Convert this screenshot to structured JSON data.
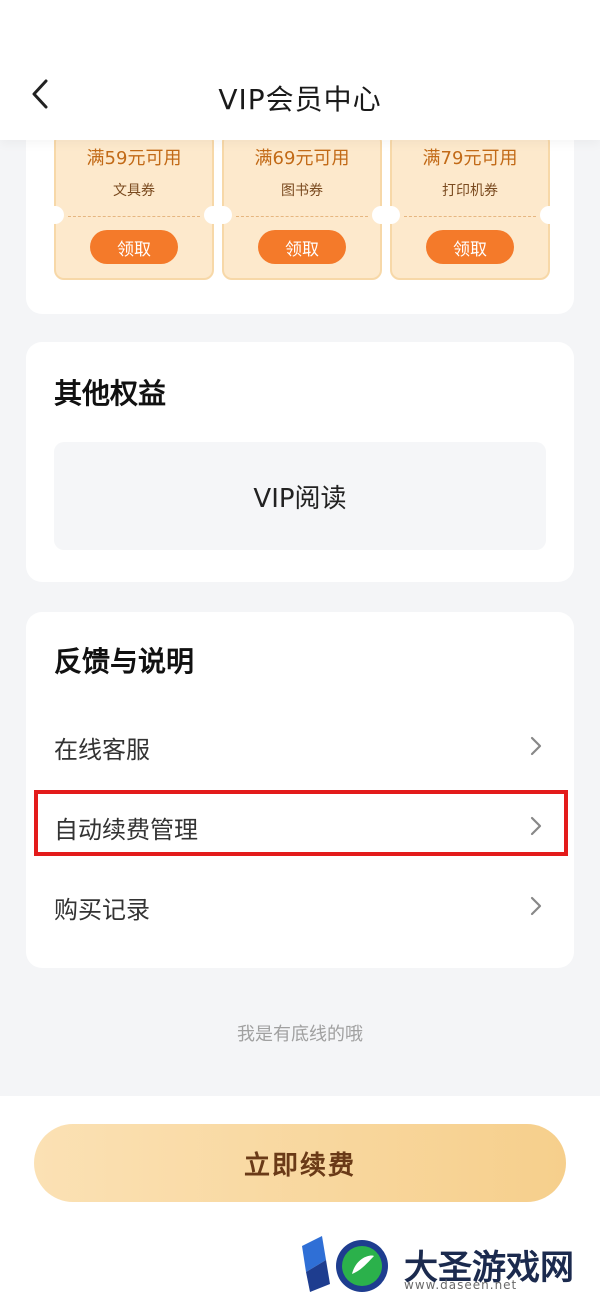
{
  "header": {
    "title": "VIP会员中心"
  },
  "coupons": [
    {
      "condition": "满59元可用",
      "type": "文具券",
      "claim": "领取"
    },
    {
      "condition": "满69元可用",
      "type": "图书券",
      "claim": "领取"
    },
    {
      "condition": "满79元可用",
      "type": "打印机券",
      "claim": "领取"
    }
  ],
  "benefits": {
    "title": "其他权益",
    "item": "VIP阅读"
  },
  "feedback": {
    "title": "反馈与说明",
    "items": [
      "在线客服",
      "自动续费管理",
      "购买记录"
    ]
  },
  "bottom_note": "我是有底线的哦",
  "renew_button": "立即续费",
  "watermark": {
    "text": "大圣游戏网",
    "url": "www.daseen.net"
  },
  "colors": {
    "accent_orange": "#f47a2a",
    "coupon_bg": "#fde9cc",
    "renew_gradient_start": "#fbe1b4",
    "renew_gradient_end": "#f6cf8c",
    "highlight_red": "#e31b1b"
  }
}
